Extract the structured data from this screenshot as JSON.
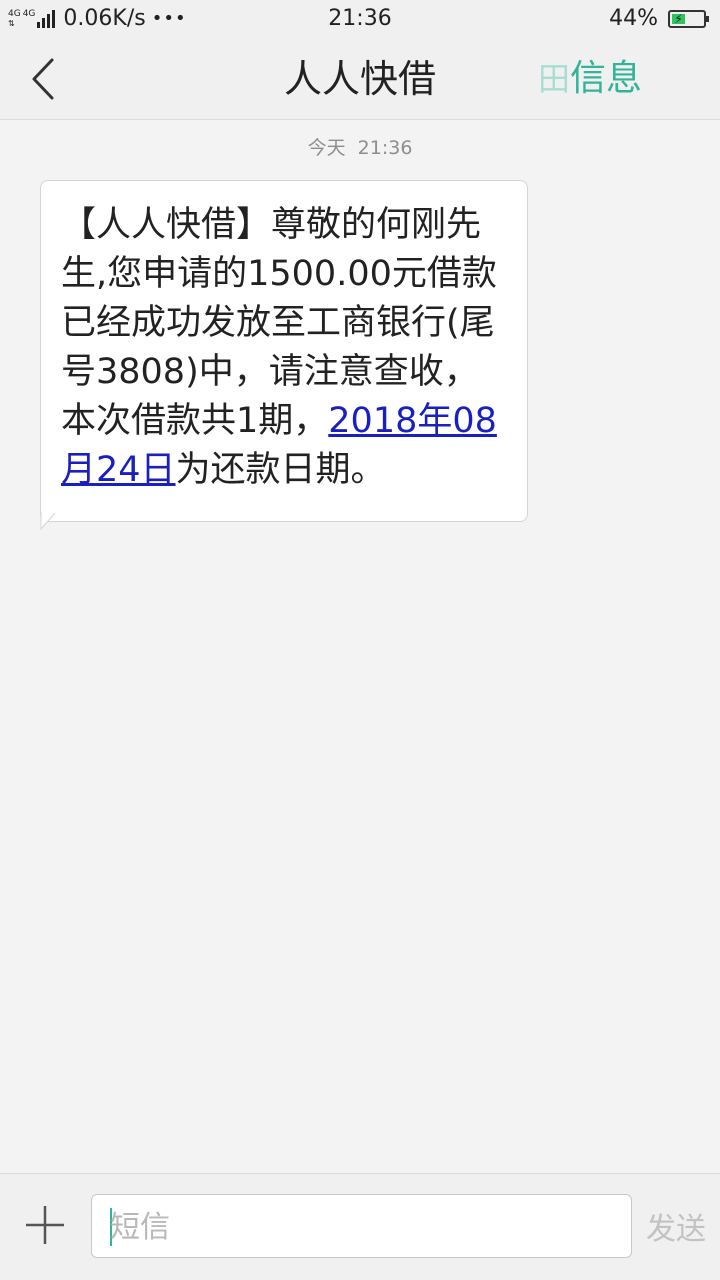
{
  "status_bar": {
    "network_tags": [
      "4G",
      "4G"
    ],
    "speed": "0.06K/s",
    "more": "•••",
    "time": "21:36",
    "battery_percent": "44%",
    "battery_level": 0.44,
    "battery_charging": true
  },
  "nav": {
    "title": "人人快借",
    "action_partial": "田",
    "action_label": "信息"
  },
  "conversation": {
    "timestamp": "今天  21:36",
    "message": {
      "text_before": "【人人快借】尊敬的何刚先生,您申请的1500.00元借款已经成功发放至工商银行(尾号3808)中，请注意查收，本次借款共1期，",
      "link_text": "2018年08月24日",
      "text_after": "为还款日期。"
    }
  },
  "input_bar": {
    "placeholder": "短信",
    "send_label": "发送"
  },
  "colors": {
    "accent": "#33b39a",
    "link": "#1a1fc0",
    "battery_fill": "#2fc262"
  }
}
